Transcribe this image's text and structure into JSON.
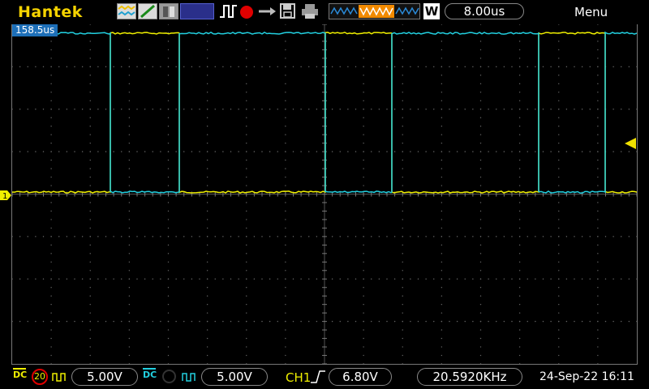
{
  "topbar": {
    "brand": "Hantek",
    "timebase": "8.00us",
    "window_label": "W",
    "menu_label": "Menu"
  },
  "screen": {
    "trigger_position": "158.5us",
    "ch1_marker": "1"
  },
  "bottombar": {
    "ch1": {
      "coupling": "DC",
      "bandwidth_limit": "20",
      "volts_div": "5.00V"
    },
    "ch2": {
      "coupling": "DC",
      "volts_div": "5.00V"
    },
    "trigger": {
      "source": "CH1",
      "level": "6.80V"
    },
    "frequency": "20.5920KHz",
    "datetime": "24-Sep-22 16:11"
  },
  "colors": {
    "ch1": "#f0f000",
    "ch2": "#22d0e0",
    "brand": "#f5d300",
    "trigger_marker": "#f0e000",
    "time_marker": "#1d6fb8"
  },
  "icons": [
    "wave-icon",
    "slope-icon",
    "cursor-icon",
    "pulse-icon",
    "record-icon",
    "arrow-icon",
    "save-icon",
    "print-icon",
    "waveform-window-icon",
    "ac-icon"
  ]
}
